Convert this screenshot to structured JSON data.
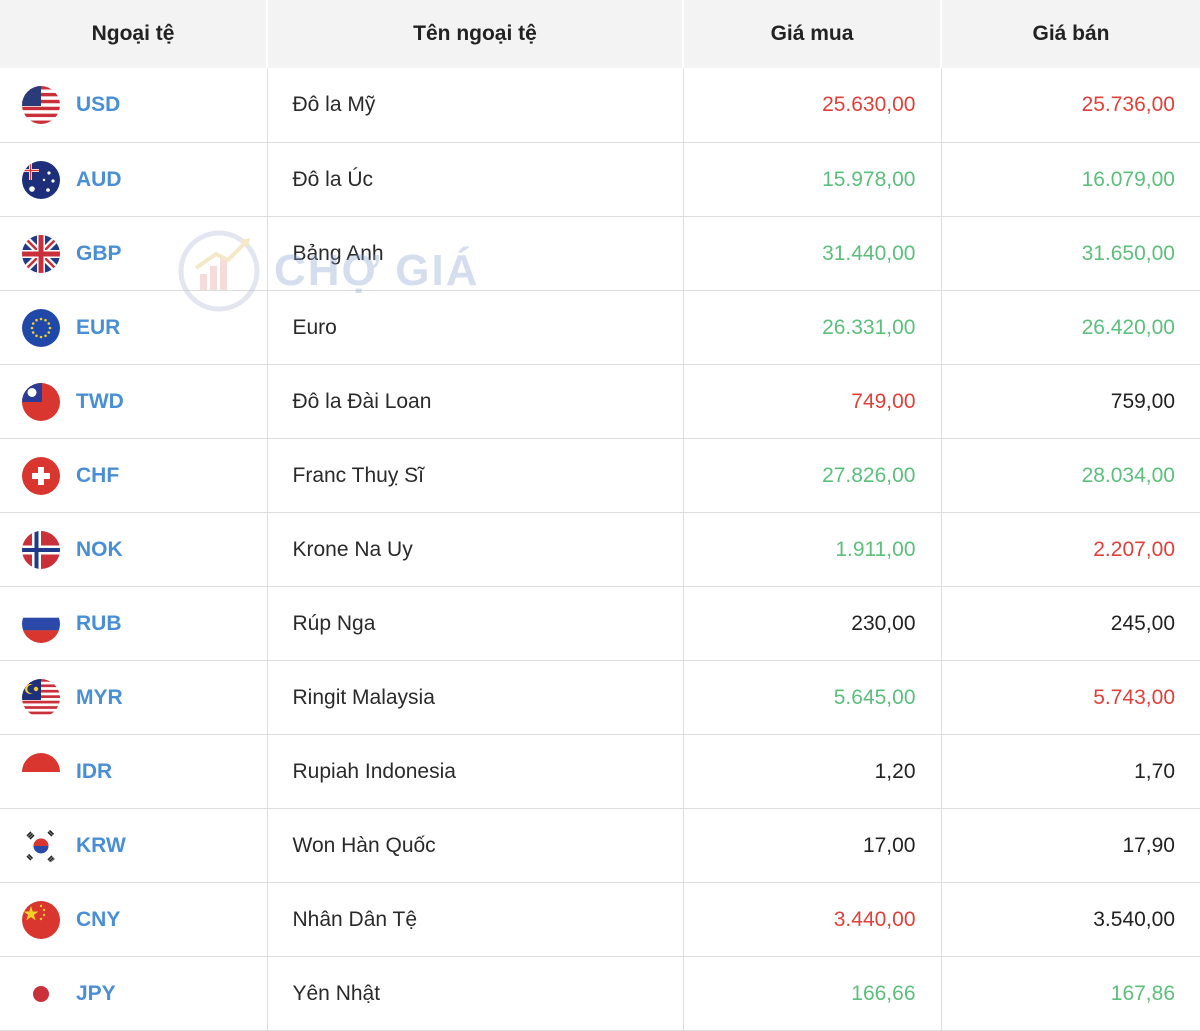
{
  "header": {
    "code": "Ngoại tệ",
    "name": "Tên ngoại tệ",
    "buy": "Giá mua",
    "sell": "Giá bán"
  },
  "watermark": {
    "text": "CHỢ GIÁ"
  },
  "colors": {
    "up": "#5cbf7b",
    "down": "#e0403a",
    "neutral": "#222222",
    "code": "#4a8fd6"
  },
  "rows": [
    {
      "code": "USD",
      "name": "Đô la Mỹ",
      "buy": "25.630,00",
      "sell": "25.736,00",
      "buy_trend": "down",
      "sell_trend": "down",
      "flag": "us-flag-icon"
    },
    {
      "code": "AUD",
      "name": "Đô la Úc",
      "buy": "15.978,00",
      "sell": "16.079,00",
      "buy_trend": "up",
      "sell_trend": "up",
      "flag": "au-flag-icon"
    },
    {
      "code": "GBP",
      "name": "Bảng Anh",
      "buy": "31.440,00",
      "sell": "31.650,00",
      "buy_trend": "up",
      "sell_trend": "up",
      "flag": "gb-flag-icon"
    },
    {
      "code": "EUR",
      "name": "Euro",
      "buy": "26.331,00",
      "sell": "26.420,00",
      "buy_trend": "up",
      "sell_trend": "up",
      "flag": "eu-flag-icon"
    },
    {
      "code": "TWD",
      "name": "Đô la Đài Loan",
      "buy": "749,00",
      "sell": "759,00",
      "buy_trend": "down",
      "sell_trend": "neutral",
      "flag": "tw-flag-icon"
    },
    {
      "code": "CHF",
      "name": "Franc Thuỵ Sĩ",
      "buy": "27.826,00",
      "sell": "28.034,00",
      "buy_trend": "up",
      "sell_trend": "up",
      "flag": "ch-flag-icon"
    },
    {
      "code": "NOK",
      "name": "Krone Na Uy",
      "buy": "1.911,00",
      "sell": "2.207,00",
      "buy_trend": "up",
      "sell_trend": "down",
      "flag": "no-flag-icon"
    },
    {
      "code": "RUB",
      "name": "Rúp Nga",
      "buy": "230,00",
      "sell": "245,00",
      "buy_trend": "neutral",
      "sell_trend": "neutral",
      "flag": "ru-flag-icon"
    },
    {
      "code": "MYR",
      "name": "Ringit Malaysia",
      "buy": "5.645,00",
      "sell": "5.743,00",
      "buy_trend": "up",
      "sell_trend": "down",
      "flag": "my-flag-icon"
    },
    {
      "code": "IDR",
      "name": "Rupiah Indonesia",
      "buy": "1,20",
      "sell": "1,70",
      "buy_trend": "neutral",
      "sell_trend": "neutral",
      "flag": "id-flag-icon"
    },
    {
      "code": "KRW",
      "name": "Won Hàn Quốc",
      "buy": "17,00",
      "sell": "17,90",
      "buy_trend": "neutral",
      "sell_trend": "neutral",
      "flag": "kr-flag-icon"
    },
    {
      "code": "CNY",
      "name": "Nhân Dân Tệ",
      "buy": "3.440,00",
      "sell": "3.540,00",
      "buy_trend": "down",
      "sell_trend": "neutral",
      "flag": "cn-flag-icon"
    },
    {
      "code": "JPY",
      "name": "Yên Nhật",
      "buy": "166,66",
      "sell": "167,86",
      "buy_trend": "up",
      "sell_trend": "up",
      "flag": "jp-flag-icon"
    }
  ]
}
